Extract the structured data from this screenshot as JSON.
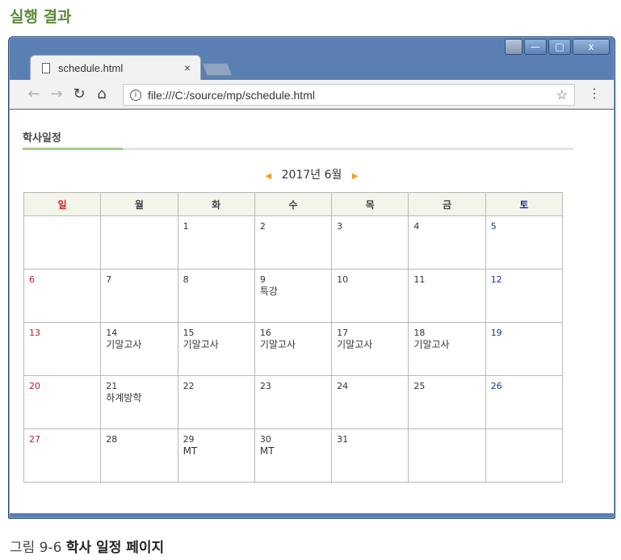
{
  "book_title": "실행 결과",
  "caption": {
    "number": "그림 9-6",
    "text": "학사 일정 페이지"
  },
  "window": {
    "tab_title": "schedule.html",
    "tab_close": "×",
    "url": "file:///C:/source/mp/schedule.html",
    "controls": {
      "minimize": "—",
      "maximize": "□",
      "close": "x"
    }
  },
  "page": {
    "heading": "학사일정",
    "month_label": "2017년 6월",
    "prev_arrow": "◀",
    "next_arrow": "▶",
    "weekdays": [
      "일",
      "월",
      "화",
      "수",
      "목",
      "금",
      "토"
    ],
    "weeks": [
      [
        {
          "day": "",
          "event": ""
        },
        {
          "day": "",
          "event": ""
        },
        {
          "day": "1",
          "event": ""
        },
        {
          "day": "2",
          "event": ""
        },
        {
          "day": "3",
          "event": ""
        },
        {
          "day": "4",
          "event": ""
        },
        {
          "day": "5",
          "event": ""
        }
      ],
      [
        {
          "day": "6",
          "event": ""
        },
        {
          "day": "7",
          "event": ""
        },
        {
          "day": "8",
          "event": ""
        },
        {
          "day": "9",
          "event": "특강"
        },
        {
          "day": "10",
          "event": ""
        },
        {
          "day": "11",
          "event": ""
        },
        {
          "day": "12",
          "event": ""
        }
      ],
      [
        {
          "day": "13",
          "event": ""
        },
        {
          "day": "14",
          "event": "기말고사"
        },
        {
          "day": "15",
          "event": "기말고사"
        },
        {
          "day": "16",
          "event": "기말고사"
        },
        {
          "day": "17",
          "event": "기말고사"
        },
        {
          "day": "18",
          "event": "기말고사"
        },
        {
          "day": "19",
          "event": ""
        }
      ],
      [
        {
          "day": "20",
          "event": ""
        },
        {
          "day": "21",
          "event": "하계방학"
        },
        {
          "day": "22",
          "event": ""
        },
        {
          "day": "23",
          "event": ""
        },
        {
          "day": "24",
          "event": ""
        },
        {
          "day": "25",
          "event": ""
        },
        {
          "day": "26",
          "event": ""
        }
      ],
      [
        {
          "day": "27",
          "event": ""
        },
        {
          "day": "28",
          "event": ""
        },
        {
          "day": "29",
          "event": "MT"
        },
        {
          "day": "30",
          "event": "MT"
        },
        {
          "day": "31",
          "event": ""
        },
        {
          "day": "",
          "event": ""
        },
        {
          "day": "",
          "event": ""
        }
      ]
    ]
  },
  "colors": {
    "sunday": "#c02020",
    "saturday": "#2030a0",
    "accent_green": "#5d8a3a",
    "arrow": "#f0a020"
  }
}
